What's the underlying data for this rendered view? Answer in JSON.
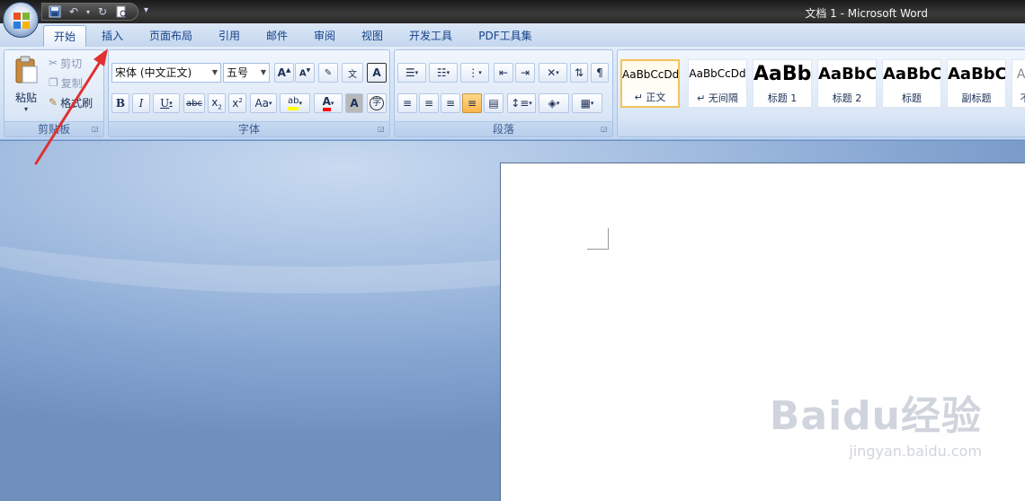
{
  "window": {
    "title": "文档 1 - Microsoft Word"
  },
  "tabs": [
    {
      "label": "开始"
    },
    {
      "label": "插入"
    },
    {
      "label": "页面布局"
    },
    {
      "label": "引用"
    },
    {
      "label": "邮件"
    },
    {
      "label": "审阅"
    },
    {
      "label": "视图"
    },
    {
      "label": "开发工具"
    },
    {
      "label": "PDF工具集"
    }
  ],
  "clipboard": {
    "group_label": "剪贴板",
    "paste": "粘贴",
    "cut": "剪切",
    "copy": "复制",
    "format_painter": "格式刷"
  },
  "font": {
    "group_label": "字体",
    "font_name": "宋体 (中文正文)",
    "font_size": "五号"
  },
  "paragraph": {
    "group_label": "段落"
  },
  "styles": [
    {
      "preview": "AaBbCcDd",
      "name": "↵ 正文"
    },
    {
      "preview": "AaBbCcDd",
      "name": "↵ 无间隔"
    },
    {
      "preview": "AaBb",
      "name": "标题 1"
    },
    {
      "preview": "AaBbC",
      "name": "标题 2"
    },
    {
      "preview": "AaBbC",
      "name": "标题"
    },
    {
      "preview": "AaBbC",
      "name": "副标题"
    },
    {
      "preview": "Aa",
      "name": "不"
    }
  ],
  "watermark": {
    "main": "Baidu经验",
    "sub": "jingyan.baidu.com"
  },
  "colors": {
    "annotation_arrow": "#e03030",
    "highlight": "#ffff00",
    "font_color": "#ff0000"
  }
}
